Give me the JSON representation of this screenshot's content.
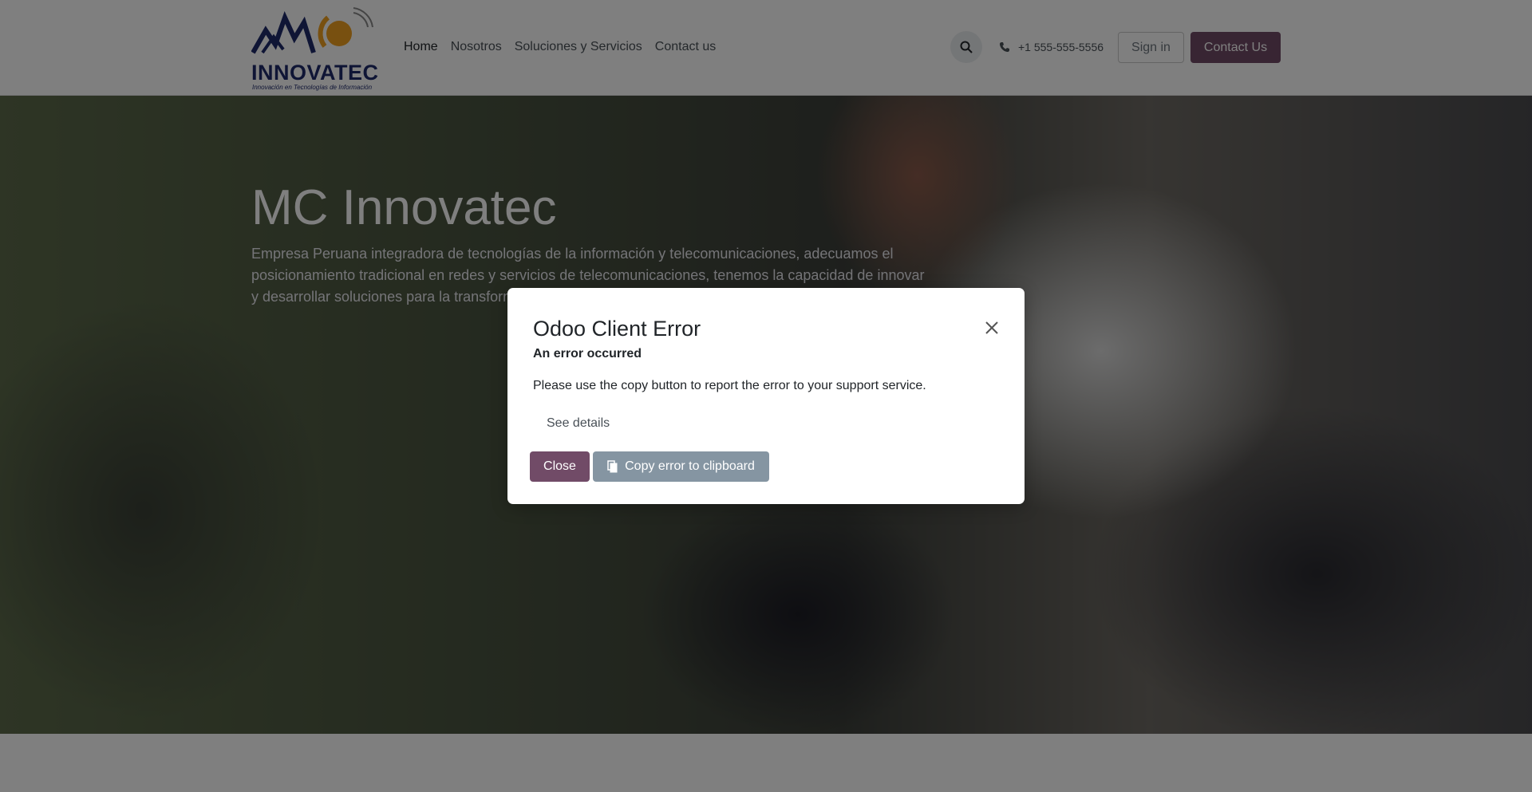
{
  "header": {
    "logo_text": "INNOVATEC",
    "logo_tagline": "Innovación en Tecnologías de Información",
    "nav": [
      {
        "label": "Home"
      },
      {
        "label": "Nosotros"
      },
      {
        "label": "Soluciones y Servicios"
      },
      {
        "label": "Contact us"
      }
    ],
    "phone": "+1 555-555-5556",
    "signin_label": "Sign in",
    "contact_label": "Contact Us"
  },
  "hero": {
    "title": "MC Innovatec",
    "text": "Empresa Peruana integradora de tecnologías de la información y telecomunicaciones, adecuamos el posicionamiento tradicional en redes y servicios de telecomunicaciones, tenemos la capacidad de innovar y desarrollar soluciones para la transform"
  },
  "dialog": {
    "title": "Odoo Client Error",
    "subtitle": "An error occurred",
    "message": "Please use the copy button to report the error to your support service.",
    "details_label": "See details",
    "close_label": "Close",
    "copy_label": "Copy error to clipboard"
  },
  "colors": {
    "primary": "#714B67",
    "secondary": "#8595a2",
    "logo_blue": "#1f2a6b",
    "logo_orange": "#f0a020"
  }
}
